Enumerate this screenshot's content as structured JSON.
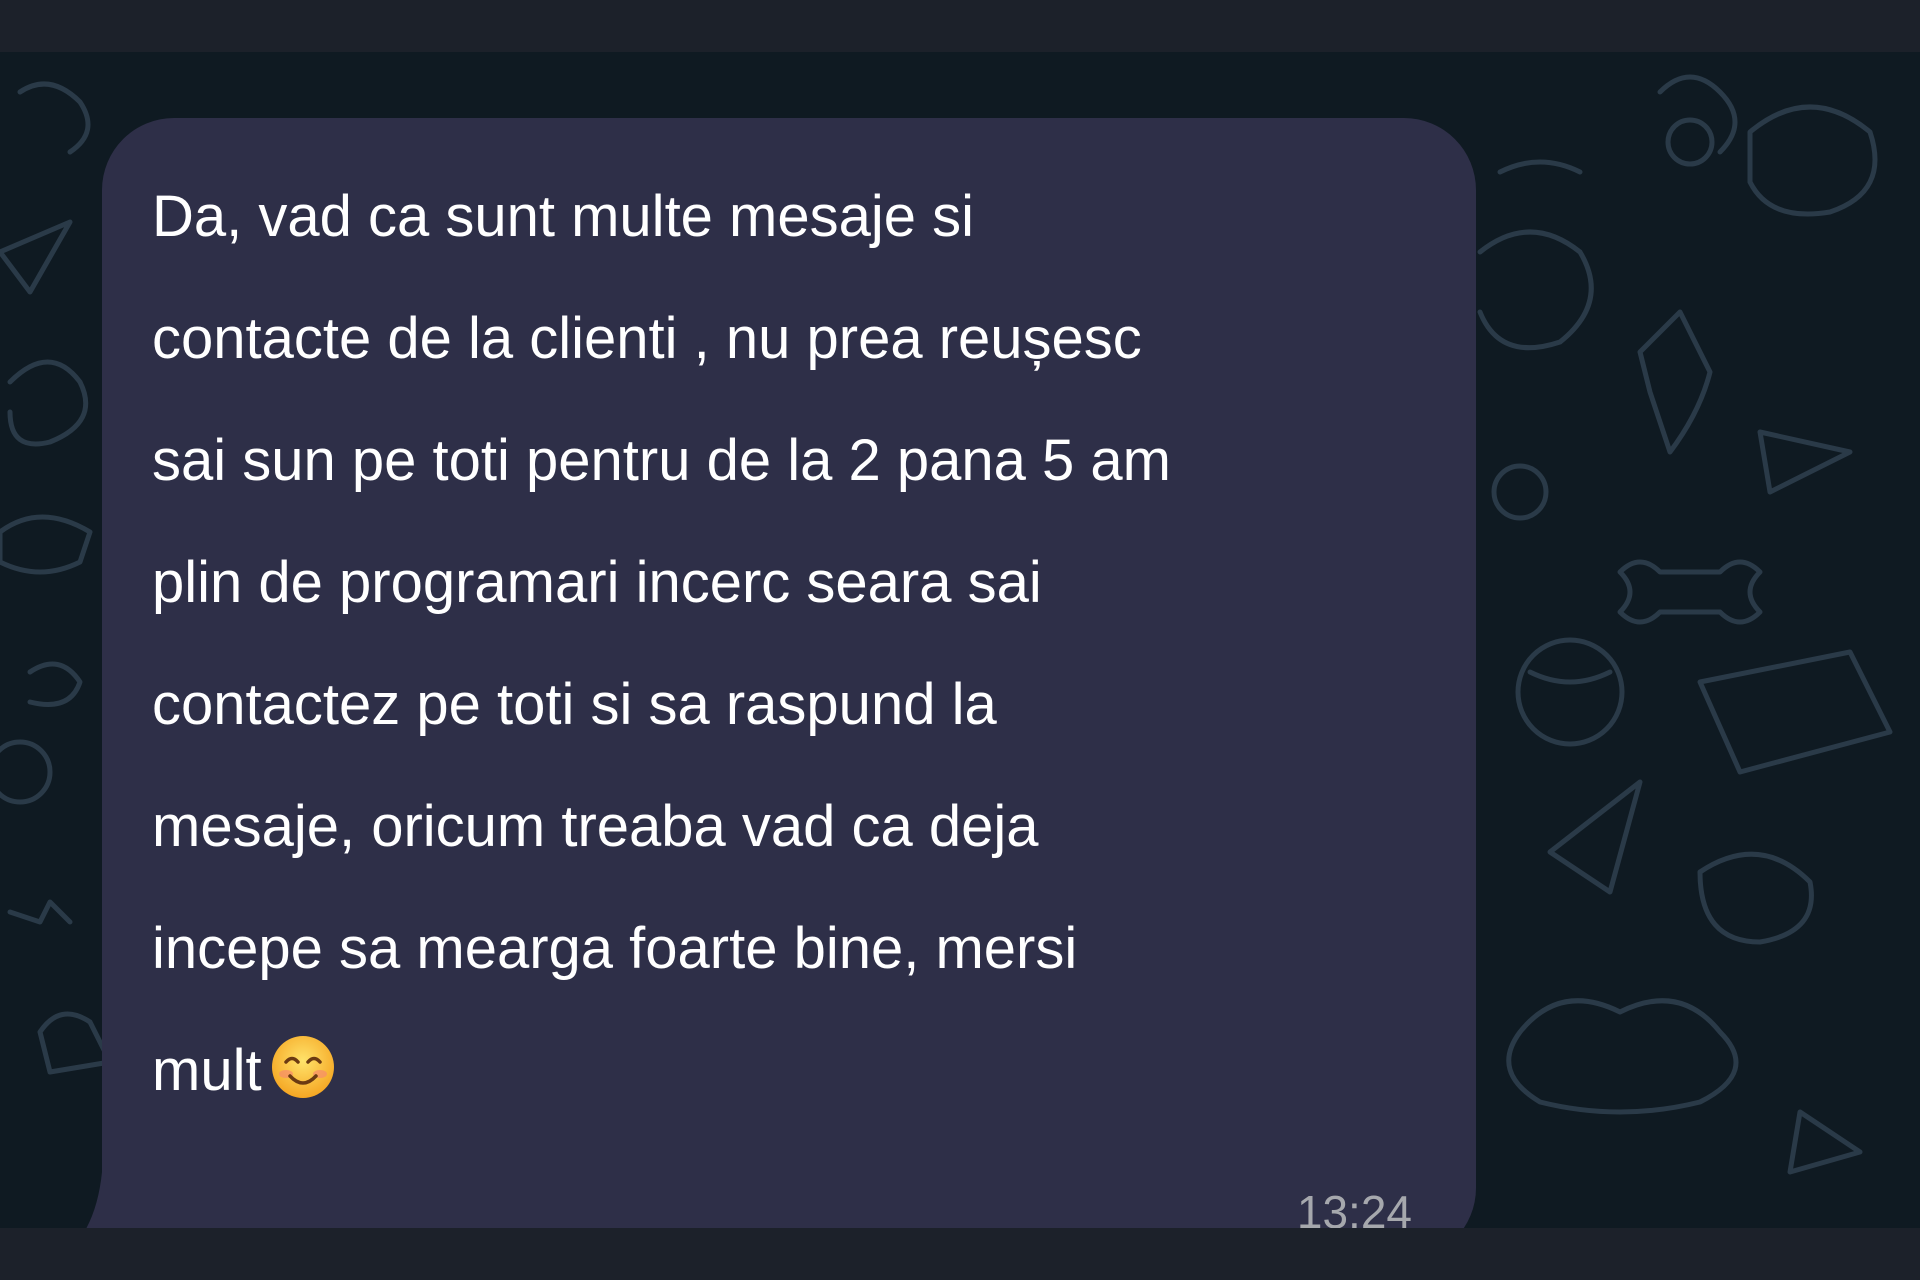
{
  "message": {
    "lines": [
      "Da, vad ca sunt multe mesaje si",
      "contacte de la clienti , nu prea reușesc",
      "sai sun pe toti pentru de la 2 pana 5 am",
      "plin de programari incerc seara sai",
      "contactez pe toti si sa raspund la",
      "mesaje, oricum treaba vad ca deja",
      "incepe sa mearga foarte bine, mersi",
      "mult"
    ],
    "emoji": "smiling-face-with-smiling-eyes-icon",
    "timestamp": "13:24"
  },
  "colors": {
    "bubble": "#2e2f48",
    "background": "#0f1a22",
    "text": "#ffffff",
    "timestamp": "#a6a8ad"
  }
}
